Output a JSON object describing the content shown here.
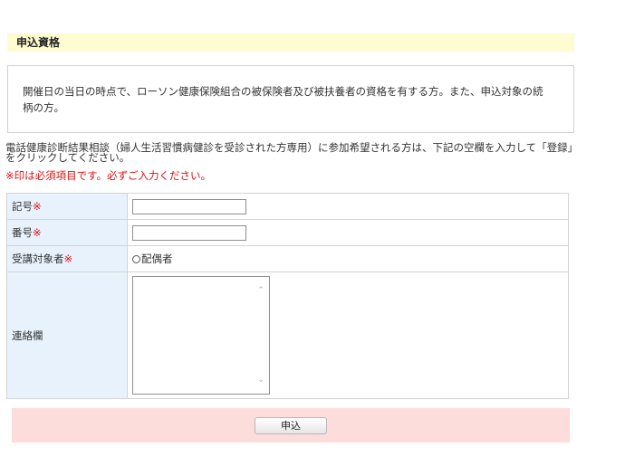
{
  "section": {
    "title": "申込資格"
  },
  "eligibility": {
    "text": "開催日の当日の時点で、ローソン健康保険組合の被保険者及び被扶養者の資格を有する方。また、申込対象の続柄の方。"
  },
  "intro": {
    "text": "電話健康診断結果相談（婦人生活習慣病健診を受診された方専用）に参加希望される方は、下記の空欄を入力して「登録」をクリックしてください。"
  },
  "required_note": "※印は必須項目です。必ずご入力ください。",
  "form": {
    "required_mark": "※",
    "fields": {
      "kigo": {
        "label": "記号",
        "value": ""
      },
      "bango": {
        "label": "番号",
        "value": ""
      },
      "target": {
        "label": "受講対象者",
        "option": "配偶者",
        "selected": false
      },
      "contact": {
        "label": "連絡欄",
        "value": ""
      }
    }
  },
  "submit": {
    "label": "申込"
  },
  "colors": {
    "header_bg": "#fefcd0",
    "label_bg": "#e8f2fc",
    "required": "#dd1111",
    "submit_bar_bg": "#fddcdc"
  }
}
